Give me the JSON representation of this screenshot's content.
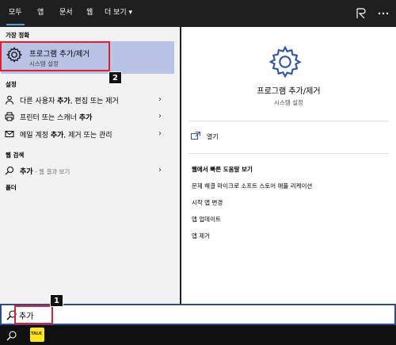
{
  "tabs": [
    {
      "label": "모두",
      "active": true
    },
    {
      "label": "앱",
      "active": false
    },
    {
      "label": "문서",
      "active": false
    },
    {
      "label": "웹",
      "active": false
    },
    {
      "label": "더 보기 ▾",
      "active": false
    }
  ],
  "best_match": {
    "header": "가장 정확",
    "title": "프로그램 추가/제거",
    "subtitle": "시스템 설정"
  },
  "settings": {
    "header": "설정",
    "items": [
      {
        "pre": "다른 사용자 ",
        "bold": "추가",
        "post": ", 편집 또는 제거"
      },
      {
        "pre": "프린터 또는 스캐너 ",
        "bold": "추가",
        "post": ""
      },
      {
        "pre": "메일 계정 ",
        "bold": "추가",
        "post": ", 제거 또는 관리"
      }
    ]
  },
  "web_search": {
    "header": "웹 검색",
    "query": "추가",
    "suffix": " - 웹 결과 보기"
  },
  "folders": {
    "header": "폴더"
  },
  "preview": {
    "title": "프로그램 추가/제거",
    "subtitle": "시스템 설정",
    "open_label": "열기",
    "help_header": "웹에서 빠른 도움말 보기",
    "help_items": [
      "문제 해결 마이크로 소프트 스토어 애플 리케이션",
      "시작 앱 변경",
      "앱 업데이트",
      "앱 제거"
    ]
  },
  "search": {
    "value": "추가"
  },
  "annotations": [
    "1",
    "2"
  ],
  "colors": {
    "selection": "#b8c3e6",
    "annotation": "#e0202f",
    "search_border": "#2e4a9a"
  },
  "icons": {
    "best": "gear-icon",
    "user": "person-icon",
    "printer": "printer-icon",
    "mail": "mail-icon",
    "search": "search-icon",
    "kakao": "kakaotalk-icon"
  }
}
